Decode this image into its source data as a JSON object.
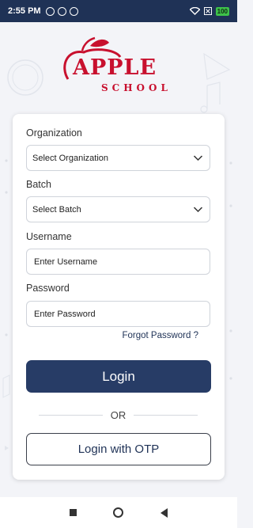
{
  "status_bar": {
    "time": "2:55 PM",
    "battery": "100"
  },
  "logo": {
    "brand": "APPLE",
    "sub": "SCHOOL"
  },
  "form": {
    "organization_label": "Organization",
    "organization_value": "Select Organization",
    "batch_label": "Batch",
    "batch_value": "Select Batch",
    "username_label": "Username",
    "username_placeholder": "Enter Username",
    "password_label": "Password",
    "password_placeholder": "Enter Password",
    "forgot_password": "Forgot Password ?",
    "login_button": "Login",
    "or_text": "OR",
    "otp_button": "Login with OTP"
  },
  "colors": {
    "primary": "#273c66",
    "brand_red": "#c8102e",
    "status_bar": "#1f3256"
  },
  "icons": {
    "dropdown": "chevron-down-icon",
    "nav_recent": "square-icon",
    "nav_home": "circle-icon",
    "nav_back": "triangle-back-icon"
  }
}
